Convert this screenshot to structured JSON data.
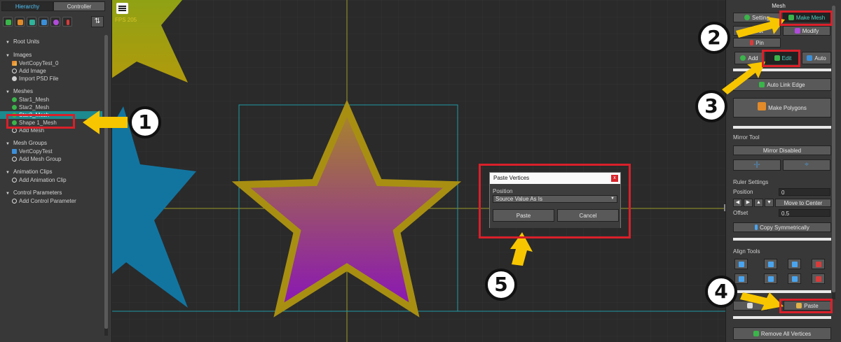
{
  "left_panel": {
    "tabs": [
      "Hierarchy",
      "Controller"
    ],
    "sort_icon": "⇅",
    "sections": [
      {
        "title": "Root Units",
        "items": []
      },
      {
        "title": "Images",
        "items": [
          {
            "label": "VertCopyTest_0",
            "icon": "img"
          },
          {
            "label": "Add Image",
            "icon": "add"
          },
          {
            "label": "Import PSD File",
            "icon": "psd"
          }
        ]
      },
      {
        "title": "Meshes",
        "items": [
          {
            "label": "Star1_Mesh",
            "icon": "mesh"
          },
          {
            "label": "Star2_Mesh",
            "icon": "mesh"
          },
          {
            "label": "Star3_Mesh",
            "icon": "mesh",
            "selected": true
          },
          {
            "label": "Shape 1_Mesh",
            "icon": "mesh"
          },
          {
            "label": "Add Mesh",
            "icon": "add"
          }
        ]
      },
      {
        "title": "Mesh Groups",
        "items": [
          {
            "label": "VertCopyTest",
            "icon": "grp"
          },
          {
            "label": "Add Mesh Group",
            "icon": "add"
          }
        ]
      },
      {
        "title": "Animation Clips",
        "items": [
          {
            "label": "Add Animation Clip",
            "icon": "add"
          }
        ]
      },
      {
        "title": "Control Parameters",
        "items": [
          {
            "label": "Add Control Parameter",
            "icon": "add"
          }
        ]
      }
    ]
  },
  "viewport": {
    "fps": "FPS 205"
  },
  "dialog": {
    "title": "Paste Vertices",
    "close": "x",
    "position_label": "Position",
    "position_value": "Source Value As Is",
    "paste": "Paste",
    "cancel": "Cancel"
  },
  "inspector": {
    "title": "Mesh",
    "setting": "Setting",
    "make_mesh": "Make Mesh",
    "pivot": "Pivot",
    "modify": "Modify",
    "pin": "Pin",
    "add": "Add",
    "edit": "Edit",
    "auto": "Auto",
    "auto_link_edge": "Auto Link Edge",
    "make_polygons": "Make Polygons",
    "mirror_tool": "Mirror Tool",
    "mirror_disabled": "Mirror Disabled",
    "ruler_settings": "Ruler Settings",
    "position": "Position",
    "position_value": "0",
    "move_to_center": "Move to Center",
    "offset": "Offset",
    "offset_value": "0.5",
    "copy_symmetrically": "Copy Symmetrically",
    "align_tools": "Align Tools",
    "paste": "Paste",
    "remove_all_vertices": "Remove All Vertices"
  },
  "annotations": [
    "1",
    "2",
    "3",
    "4",
    "5"
  ],
  "colors": {
    "accent": "#4fc3f7",
    "selection": "#1c8a8f",
    "highlight": "#d9202a",
    "arrow": "#f7c600"
  }
}
